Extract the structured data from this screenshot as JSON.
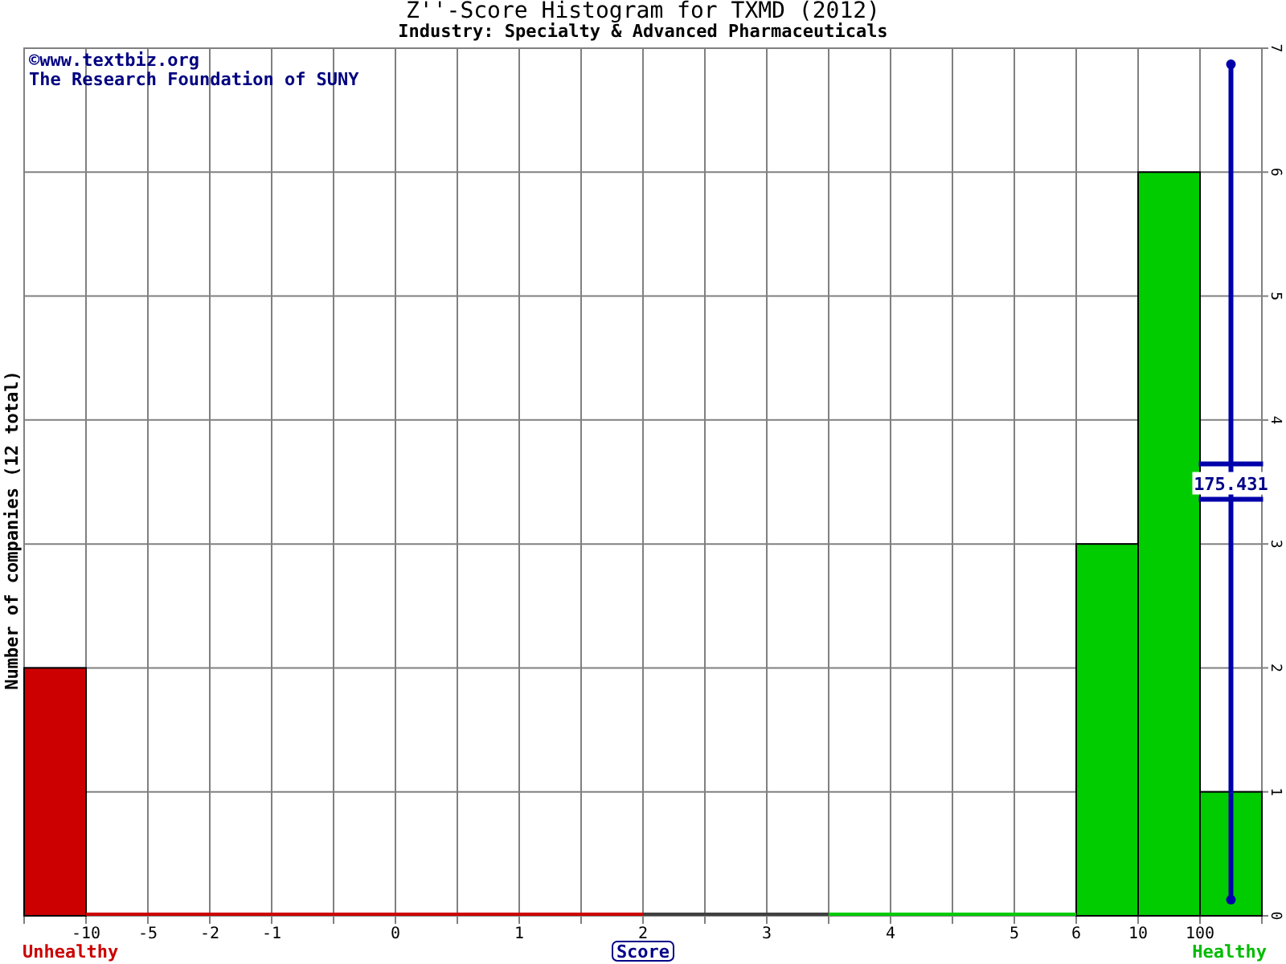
{
  "title": "Z''-Score Histogram for TXMD (2012)",
  "subtitle": "Industry: Specialty & Advanced Pharmaceuticals",
  "credits": [
    "©www.textbiz.org",
    "The Research Foundation of SUNY"
  ],
  "scale_ends": [
    {
      "text": "Unhealthy",
      "color": "#cc0000"
    },
    {
      "text": "Healthy",
      "color": "#00bb00"
    }
  ],
  "chart_data": {
    "type": "bar",
    "xlabel": "Score",
    "ylabel": "Number of companies (12 total)",
    "categories": [
      null,
      "-10",
      "-5",
      "-2",
      "-1",
      null,
      "0",
      null,
      "1",
      null,
      "2",
      null,
      "3",
      null,
      "4",
      null,
      "5",
      "6",
      "10",
      "100"
    ],
    "series": [
      {
        "color": "#cc0000",
        "values": [
          2,
          0,
          0,
          0,
          0,
          0,
          0,
          0,
          0,
          0,
          null,
          null,
          null,
          null,
          null,
          null,
          null,
          null,
          null,
          null
        ]
      },
      {
        "color": "#404040",
        "values": [
          null,
          null,
          null,
          null,
          null,
          null,
          null,
          null,
          null,
          null,
          0,
          0,
          0,
          null,
          null,
          null,
          null,
          null,
          null,
          null
        ]
      },
      {
        "color": "#00cc00",
        "values": [
          null,
          null,
          null,
          null,
          null,
          null,
          null,
          null,
          null,
          null,
          null,
          null,
          null,
          0,
          0,
          0,
          0,
          3,
          6,
          1
        ]
      }
    ],
    "ylim": [
      0,
      7
    ],
    "grid": true,
    "yticks": [
      0,
      1,
      2,
      3,
      4,
      5,
      6,
      7
    ],
    "annotations": [
      "175.431"
    ]
  }
}
